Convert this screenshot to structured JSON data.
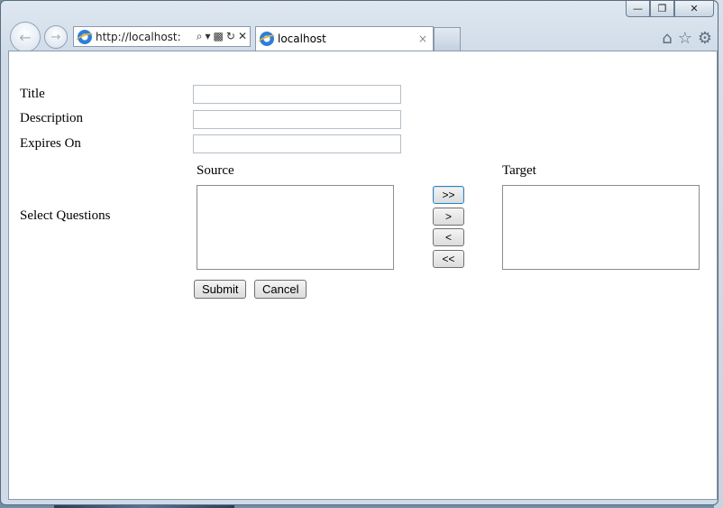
{
  "browser": {
    "address_url": "http://localhost:",
    "tab_title": "localhost",
    "tab_close": "×",
    "window_buttons": {
      "minimize": "—",
      "restore": "❐",
      "close": "✕"
    }
  },
  "form": {
    "title_label": "Title",
    "title_value": "",
    "description_label": "Description",
    "description_value": "",
    "expires_label": "Expires On",
    "expires_value": "",
    "select_questions_label": "Select Questions",
    "source_label": "Source",
    "target_label": "Target",
    "source_items": [],
    "target_items": [],
    "move_all_right": ">>",
    "move_right": ">",
    "move_left": "<",
    "move_all_left": "<<",
    "submit": "Submit",
    "cancel": "Cancel"
  }
}
